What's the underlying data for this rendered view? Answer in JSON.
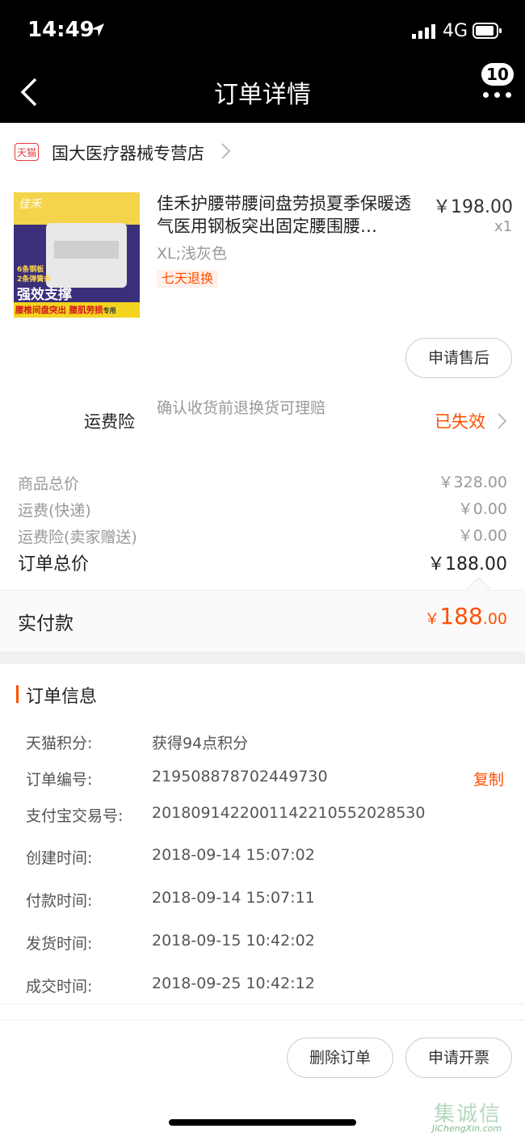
{
  "status": {
    "time": "14:49",
    "network": "4G"
  },
  "nav": {
    "title": "订单详情",
    "badge": "10"
  },
  "store": {
    "icon_text": "天猫",
    "name": "国大医疗器械专营店"
  },
  "product": {
    "name": "佳禾护腰带腰间盘劳损夏季保暖透气医用钢板突出固定腰围腰…",
    "price": "￥198.00",
    "qty": "x1",
    "sku": "XL;浅灰色",
    "tag": "七天退换",
    "thumb": {
      "brand": "佳禾",
      "line1": "6条钢板",
      "line2": "2条弹簧条",
      "headline": "强效支撑",
      "footer": "腰椎间盘突出 腰肌劳损",
      "footer_suffix": "专用"
    }
  },
  "actions": {
    "after_sale": "申请售后",
    "delete": "删除订单",
    "invoice": "申请开票"
  },
  "insurance": {
    "label": "运费险",
    "desc": "确认收货前退换货可理赔",
    "status": "已失效"
  },
  "summary": {
    "rows": [
      {
        "label": "商品总价",
        "value": "￥328.00"
      },
      {
        "label": "运费(快递)",
        "value": "￥0.00"
      },
      {
        "label": "运费险(卖家赠送)",
        "value": "￥0.00"
      }
    ],
    "total_label": "订单总价",
    "total_value": "￥188.00",
    "paid_label": "实付款",
    "paid_symbol": "￥",
    "paid_int": "188",
    "paid_dec": ".00"
  },
  "order_info": {
    "title": "订单信息",
    "copy_label": "复制",
    "rows": [
      {
        "key": "天猫积分:",
        "value": "获得94点积分"
      },
      {
        "key": "订单编号:",
        "value": "219508878702449730"
      },
      {
        "key": "支付宝交易号:",
        "value": "2018091422001142210552028530"
      },
      {
        "key": "创建时间:",
        "value": "2018-09-14 15:07:02"
      },
      {
        "key": "付款时间:",
        "value": "2018-09-14 15:07:11"
      },
      {
        "key": "发货时间:",
        "value": "2018-09-15 10:42:02"
      },
      {
        "key": "成交时间:",
        "value": "2018-09-25 10:42:12"
      }
    ]
  },
  "watermark": {
    "main": "集诚信",
    "sub": "JiChengXin.com"
  },
  "colors": {
    "accent": "#ff5000",
    "tmall": "#e4393c"
  }
}
